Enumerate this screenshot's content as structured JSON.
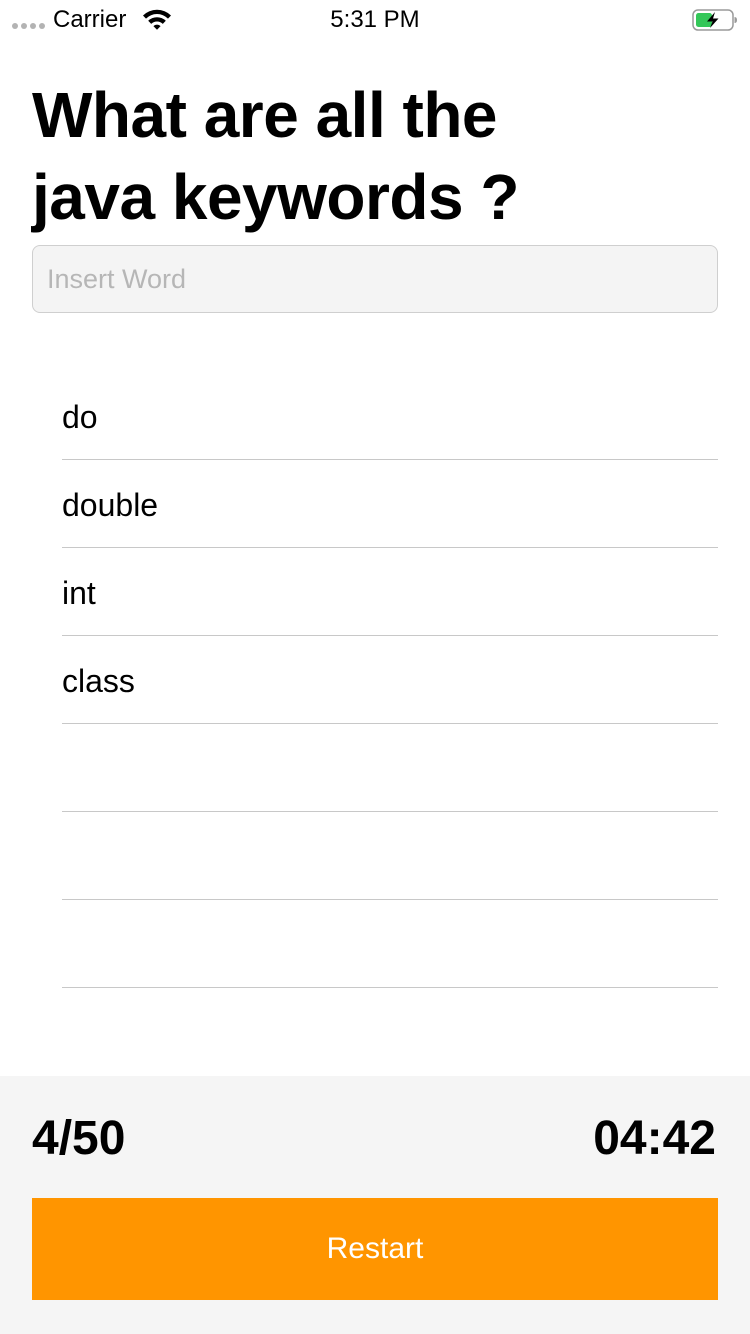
{
  "status_bar": {
    "carrier": "Carrier",
    "time": "5:31 PM",
    "battery_color": "#34c759",
    "icons": [
      "signal-dots-icon",
      "wifi-icon",
      "battery-charging-icon"
    ]
  },
  "question": {
    "title": "What are all the\njava keywords ?"
  },
  "input": {
    "value": "",
    "placeholder": "Insert Word"
  },
  "words": [
    "do",
    "double",
    "int",
    "class",
    "",
    "",
    ""
  ],
  "footer": {
    "score": "4/50",
    "timer": "04:42",
    "restart_label": "Restart",
    "accent_color": "#ff9500"
  }
}
